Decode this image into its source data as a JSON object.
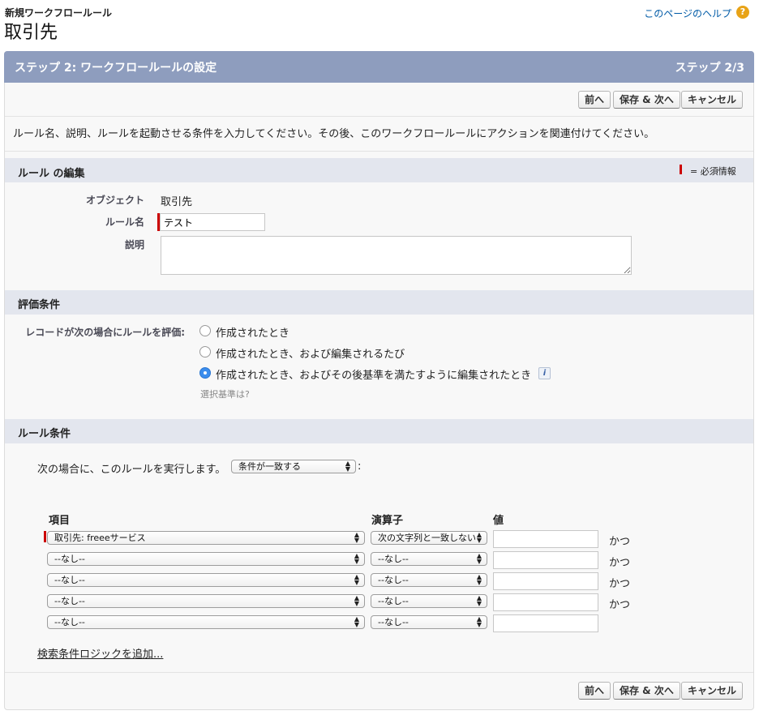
{
  "header": {
    "breadcrumb": "新規ワークフロールール",
    "title": "取引先",
    "help_link": "このページのヘルプ",
    "help_icon": "question-icon"
  },
  "step_bar": {
    "title": "ステップ 2: ワークフロールールの設定",
    "count": "ステップ 2/3"
  },
  "buttons": {
    "prev": "前へ",
    "save_next": "保存 & 次へ",
    "cancel": "キャンセル"
  },
  "intro": "ルール名、説明、ルールを起動させる条件を入力してください。その後、このワークフロールールにアクションを関連付けてください。",
  "rule_edit": {
    "title": "ルール の編集",
    "required_legend": "= 必須情報",
    "object_label": "オブジェクト",
    "object_value": "取引先",
    "name_label": "ルール名",
    "name_value": "テスト",
    "description_label": "説明",
    "description_value": ""
  },
  "evaluation": {
    "title": "評価条件",
    "label": "レコードが次の場合にルールを評価:",
    "options": [
      {
        "label": "作成されたとき",
        "selected": false
      },
      {
        "label": "作成されたとき、および編集されるたび",
        "selected": false
      },
      {
        "label": "作成されたとき、およびその後基準を満たすように編集されたとき",
        "selected": true
      }
    ],
    "info_icon": "info-icon",
    "hint": "選択基準は?"
  },
  "rule_criteria": {
    "title": "ルール条件",
    "run_label": "次の場合に、このルールを実行します。",
    "condition_select": "条件が一致する",
    "run_suffix": ":",
    "col_field": "項目",
    "col_operator": "演算子",
    "col_value": "値",
    "rows": [
      {
        "field": "取引先: freeeサービス",
        "operator": "次の文字列と一致しない",
        "value": "",
        "conj": "かつ"
      },
      {
        "field": "--なし--",
        "operator": "--なし--",
        "value": "",
        "conj": "かつ"
      },
      {
        "field": "--なし--",
        "operator": "--なし--",
        "value": "",
        "conj": "かつ"
      },
      {
        "field": "--なし--",
        "operator": "--なし--",
        "value": "",
        "conj": "かつ"
      },
      {
        "field": "--なし--",
        "operator": "--なし--",
        "value": "",
        "conj": ""
      }
    ],
    "add_logic": "検索条件ロジックを追加..."
  },
  "colors": {
    "step_bar": "#8e9dbe",
    "section_header": "#e3e6ee",
    "required": "#cc0000",
    "link": "#015ba7",
    "radio_selected": "#3b8ded"
  }
}
